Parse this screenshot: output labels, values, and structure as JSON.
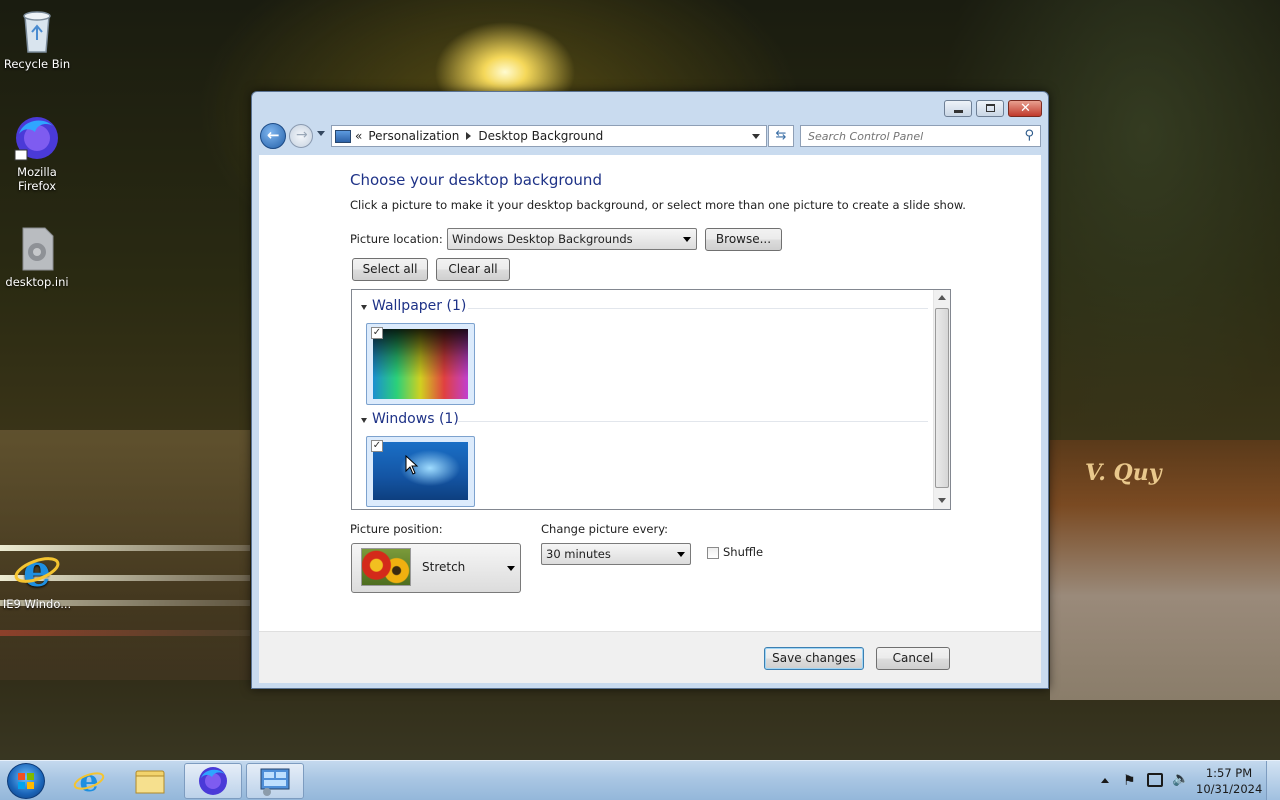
{
  "desktop": {
    "icons": [
      {
        "label": "Recycle Bin",
        "icon": "recycle-bin-icon"
      },
      {
        "label": "Mozilla Firefox",
        "icon": "firefox-icon"
      },
      {
        "label": "desktop.ini",
        "icon": "settings-file-icon"
      },
      {
        "label": "IE9 Windo...",
        "icon": "internet-explorer-icon"
      }
    ],
    "sign_text": "V. Quy"
  },
  "window": {
    "address": {
      "overflow": "«",
      "crumbs": [
        "Personalization",
        "Desktop Background"
      ]
    },
    "search_placeholder": "Search Control Panel",
    "heading": "Choose your desktop background",
    "description": "Click a picture to make it your desktop background, or select more than one picture to create a slide show.",
    "picture_location_label": "Picture location:",
    "picture_location_value": "Windows Desktop Backgrounds",
    "browse_label": "Browse...",
    "select_all_label": "Select all",
    "clear_all_label": "Clear all",
    "groups": [
      {
        "title": "Wallpaper (1)",
        "checked": true
      },
      {
        "title": "Windows (1)",
        "checked": true
      }
    ],
    "picture_position_label": "Picture position:",
    "picture_position_value": "Stretch",
    "change_every_label": "Change picture every:",
    "change_every_value": "30 minutes",
    "shuffle_label": "Shuffle",
    "shuffle_checked": false,
    "save_label": "Save changes",
    "cancel_label": "Cancel"
  },
  "taskbar": {
    "items": [
      "start-orb-icon",
      "internet-explorer-icon",
      "file-explorer-icon",
      "firefox-icon",
      "control-panel-icon"
    ],
    "time": "1:57 PM",
    "date": "10/31/2024"
  }
}
